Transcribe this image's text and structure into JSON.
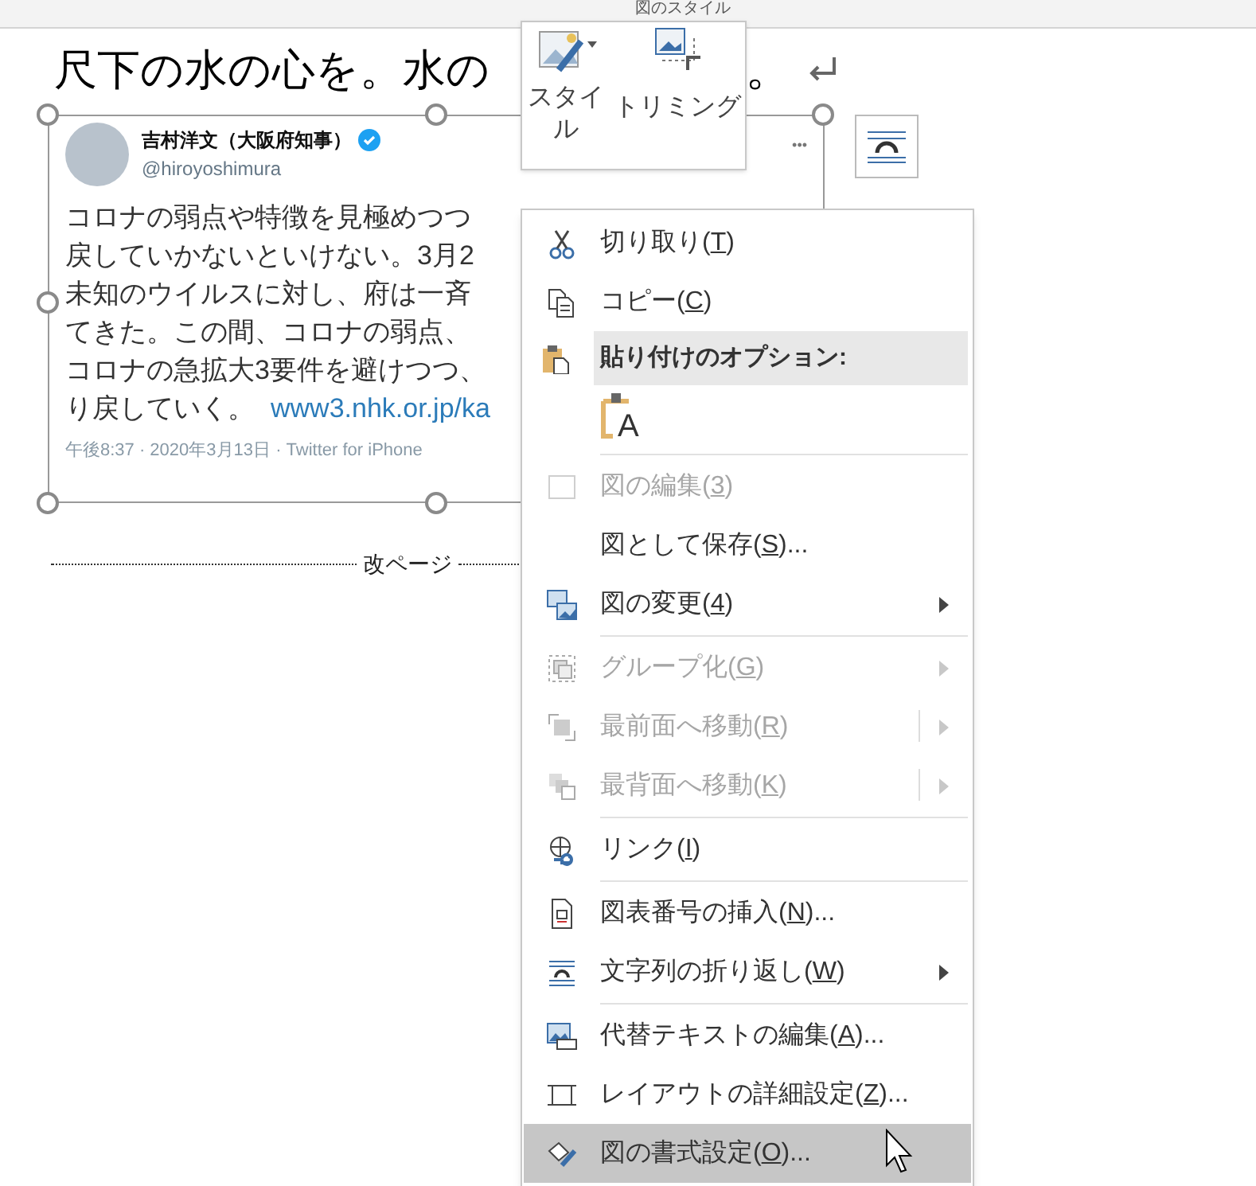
{
  "ribbon": {
    "group_label": "図のスタイル"
  },
  "heading": {
    "text": "尺下の水の心を。水の",
    "end": "。"
  },
  "mini_toolbar": {
    "buttons": [
      {
        "label": "スタイル",
        "dropdown": true
      },
      {
        "label": "トリミング",
        "dropdown": false
      }
    ]
  },
  "tweet": {
    "name": "吉村洋文（大阪府知事）",
    "verified": true,
    "handle": "@hiroyoshimura",
    "more": "•••",
    "lines": [
      "コロナの弱点や特徴を見極めつつ",
      "戻していかないといけない。3月2",
      "未知のウイルスに対し、府は一斉",
      "てきた。この間、コロナの弱点、",
      "コロナの急拡大3要件を避けつつ、",
      "り戻していく。"
    ],
    "link": "www3.nhk.or.jp/ka",
    "footer": "午後8:37 · 2020年3月13日 · Twitter for iPhone"
  },
  "page_break": {
    "label": "改ページ"
  },
  "context_menu": {
    "items": [
      {
        "kind": "item",
        "before": "切り取り(",
        "key": "T",
        "after": ")",
        "disabled": false,
        "submenu": false,
        "split": false,
        "selected": false
      },
      {
        "kind": "item",
        "before": "コピー(",
        "key": "C",
        "after": ")",
        "disabled": false,
        "submenu": false,
        "split": false,
        "selected": false
      },
      {
        "kind": "header",
        "text": "貼り付けのオプション:"
      },
      {
        "kind": "paste",
        "letter": "A"
      },
      {
        "kind": "separator"
      },
      {
        "kind": "item",
        "before": "図の編集(",
        "key": "3",
        "after": ")",
        "disabled": true,
        "submenu": false,
        "split": false,
        "selected": false
      },
      {
        "kind": "item",
        "before": "図として保存(",
        "key": "S",
        "after": ")...",
        "disabled": false,
        "submenu": false,
        "split": false,
        "selected": false
      },
      {
        "kind": "item",
        "before": "図の変更(",
        "key": "4",
        "after": ")",
        "disabled": false,
        "submenu": true,
        "split": false,
        "selected": false
      },
      {
        "kind": "separator"
      },
      {
        "kind": "item",
        "before": "グループ化(",
        "key": "G",
        "after": ")",
        "disabled": true,
        "submenu": true,
        "split": false,
        "selected": false
      },
      {
        "kind": "item",
        "before": "最前面へ移動(",
        "key": "R",
        "after": ")",
        "disabled": true,
        "submenu": true,
        "split": true,
        "selected": false
      },
      {
        "kind": "item",
        "before": "最背面へ移動(",
        "key": "K",
        "after": ")",
        "disabled": true,
        "submenu": true,
        "split": true,
        "selected": false
      },
      {
        "kind": "separator"
      },
      {
        "kind": "item",
        "before": "リンク(",
        "key": "I",
        "after": ")",
        "disabled": false,
        "submenu": false,
        "split": false,
        "selected": false
      },
      {
        "kind": "separator"
      },
      {
        "kind": "item",
        "before": "図表番号の挿入(",
        "key": "N",
        "after": ")...",
        "disabled": false,
        "submenu": false,
        "split": false,
        "selected": false
      },
      {
        "kind": "item",
        "before": "文字列の折り返し(",
        "key": "W",
        "after": ")",
        "disabled": false,
        "submenu": true,
        "split": false,
        "selected": false
      },
      {
        "kind": "separator"
      },
      {
        "kind": "item",
        "before": "代替テキストの編集(",
        "key": "A",
        "after": ")...",
        "disabled": false,
        "submenu": false,
        "split": false,
        "selected": false
      },
      {
        "kind": "item",
        "before": "レイアウトの詳細設定(",
        "key": "Z",
        "after": ")...",
        "disabled": false,
        "submenu": false,
        "split": false,
        "selected": false
      },
      {
        "kind": "item",
        "before": "図の書式設定(",
        "key": "O",
        "after": ")...",
        "disabled": false,
        "submenu": false,
        "split": false,
        "selected": true
      }
    ]
  }
}
